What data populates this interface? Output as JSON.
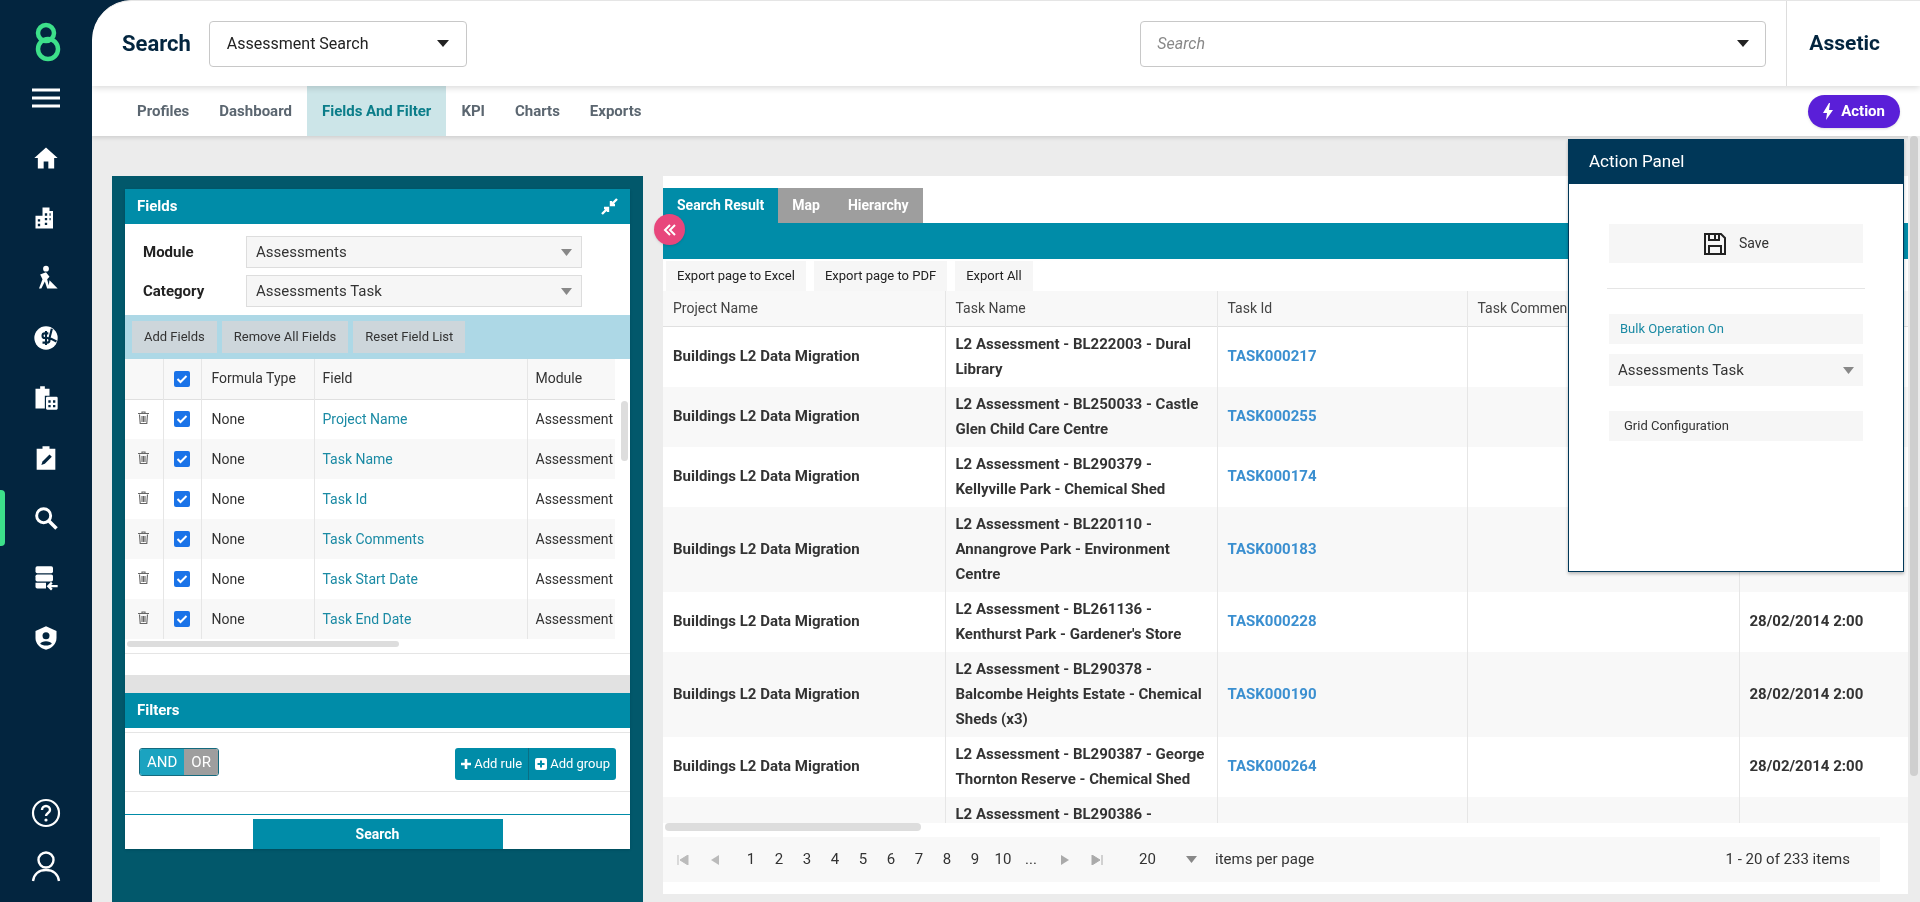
{
  "sidebar": {
    "items": [
      {
        "kind": "home",
        "selected": false
      },
      {
        "kind": "buildings",
        "selected": false
      },
      {
        "kind": "worker",
        "selected": false
      },
      {
        "kind": "finance",
        "selected": false
      },
      {
        "kind": "calculator",
        "selected": false
      },
      {
        "kind": "edit",
        "selected": false
      },
      {
        "kind": "search",
        "selected": true
      },
      {
        "kind": "server",
        "selected": false
      },
      {
        "kind": "shield",
        "selected": false
      }
    ]
  },
  "header": {
    "title": "Search",
    "search_type": {
      "value": "Assessment Search"
    },
    "search": {
      "placeholder": "Search"
    },
    "brand": "Assetic"
  },
  "tabs": [
    {
      "label": "Profiles",
      "selected": false
    },
    {
      "label": "Dashboard",
      "selected": false
    },
    {
      "label": "Fields And Filter",
      "selected": true
    },
    {
      "label": "KPI",
      "selected": false
    },
    {
      "label": "Charts",
      "selected": false
    },
    {
      "label": "Exports",
      "selected": false
    }
  ],
  "action_button": "Action",
  "fields_panel": {
    "title": "Fields",
    "module": {
      "label": "Module",
      "value": "Assessments"
    },
    "category": {
      "label": "Category",
      "value": "Assessments Task"
    },
    "buttons": [
      "Add Fields",
      "Remove All Fields",
      "Reset Field List"
    ],
    "table": {
      "all_checked": true,
      "columns": [
        "Formula Type",
        "Field",
        "Module"
      ],
      "rows": [
        {
          "checked": true,
          "formula_type": "None",
          "field": "Project Name",
          "module": "Assessment"
        },
        {
          "checked": true,
          "formula_type": "None",
          "field": "Task Name",
          "module": "Assessment"
        },
        {
          "checked": true,
          "formula_type": "None",
          "field": "Task Id",
          "module": "Assessment"
        },
        {
          "checked": true,
          "formula_type": "None",
          "field": "Task Comments",
          "module": "Assessment"
        },
        {
          "checked": true,
          "formula_type": "None",
          "field": "Task Start Date",
          "module": "Assessment"
        },
        {
          "checked": true,
          "formula_type": "None",
          "field": "Task End Date",
          "module": "Assessment"
        }
      ]
    }
  },
  "filters": {
    "title": "Filters",
    "conjunctions": [
      {
        "label": "AND",
        "selected": true
      },
      {
        "label": "OR",
        "selected": false
      }
    ],
    "buttons": [
      "Add rule",
      "Add group"
    ],
    "search_button": "Search"
  },
  "results": {
    "tabs": [
      {
        "label": "Search Result",
        "selected": true
      },
      {
        "label": "Map",
        "selected": false
      },
      {
        "label": "Hierarchy",
        "selected": false
      }
    ],
    "exports": [
      "Export page to Excel",
      "Export page to PDF",
      "Export All"
    ],
    "table": {
      "columns": [
        "Project Name",
        "Task Name",
        "Task Id",
        "Task Commen"
      ],
      "rows": [
        {
          "project_name": "Buildings L2 Data Migration",
          "task_name": "L2 Assessment - BL222003 - Dural Library",
          "task_id": "TASK000217"
        },
        {
          "project_name": "Buildings L2 Data Migration",
          "task_name": "L2 Assessment - BL250033 - Castle Glen Child Care Centre",
          "task_id": "TASK000255"
        },
        {
          "project_name": "Buildings L2 Data Migration",
          "task_name": "L2 Assessment - BL290379 - Kellyville Park - Chemical Shed",
          "task_id": "TASK000174"
        },
        {
          "project_name": "Buildings L2 Data Migration",
          "task_name": "L2 Assessment - BL220110 - Annangrove Park - Environment Centre",
          "task_id": "TASK000183"
        },
        {
          "project_name": "Buildings L2 Data Migration",
          "task_name": "L2 Assessment - BL261136 - Kenthurst Park - Gardener's Store",
          "task_id": "TASK000228",
          "column_5": "28/02/2014 2:00"
        },
        {
          "project_name": "Buildings L2 Data Migration",
          "task_name": "L2 Assessment - BL290378 - Balcombe Heights Estate - Chemical Sheds (x3)",
          "task_id": "TASK000190",
          "column_5": "28/02/2014 2:00"
        },
        {
          "project_name": "Buildings L2 Data Migration",
          "task_name": "L2 Assessment - BL290387 - George Thornton Reserve - Chemical Shed",
          "task_id": "TASK000264",
          "column_5": "28/02/2014 2:00"
        },
        {
          "task_name": "L2 Assessment - BL290386 -"
        }
      ]
    },
    "pager": {
      "pages": [
        "1",
        "2",
        "3",
        "4",
        "5",
        "6",
        "7",
        "8",
        "9",
        "10",
        "..."
      ],
      "page_size": "20",
      "page_size_label": "items per page",
      "summary": "1 - 20 of 233 items"
    }
  },
  "action_panel": {
    "title": "Action Panel",
    "save": "Save",
    "bulk_operation": "Bulk Operation On",
    "category": "Assessments Task",
    "grid_configuration": "Grid Configuration"
  }
}
